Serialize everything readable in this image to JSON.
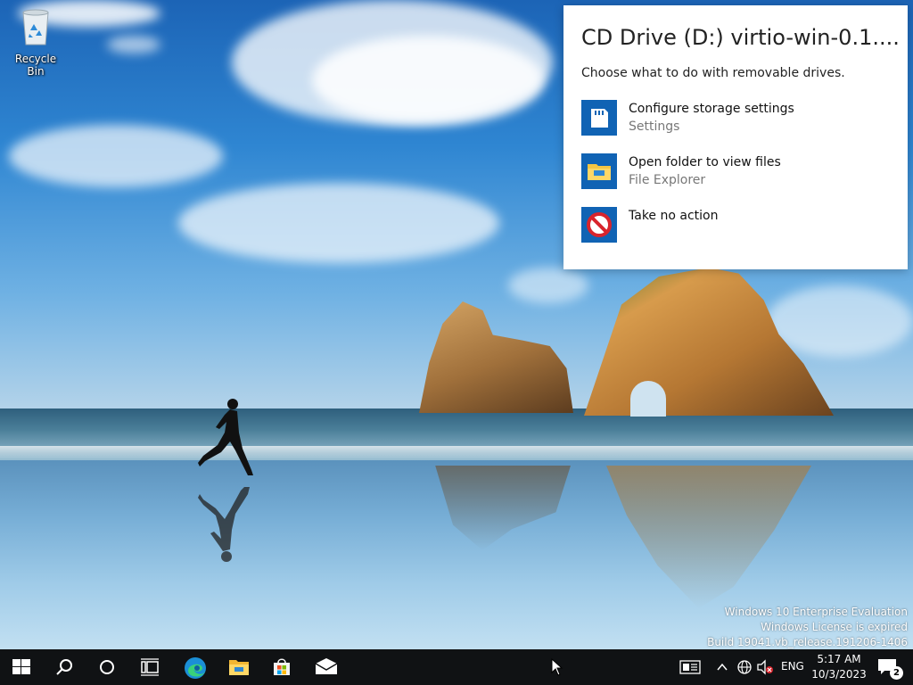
{
  "desktop": {
    "recycle_bin_label": "Recycle Bin"
  },
  "watermark": {
    "line1": "Windows 10 Enterprise Evaluation",
    "line2": "Windows License is expired",
    "line3": "Build 19041.vb_release.191206-1406"
  },
  "autoplay": {
    "title": "CD Drive (D:) virtio-win-0.1....",
    "subtitle": "Choose what to do with removable drives.",
    "options": [
      {
        "label": "Configure storage settings",
        "sublabel": "Settings",
        "icon": "sd-card-icon"
      },
      {
        "label": "Open folder to view files",
        "sublabel": "File Explorer",
        "icon": "folder-icon"
      },
      {
        "label": "Take no action",
        "sublabel": "",
        "icon": "no-action-icon"
      }
    ],
    "accent": "#1063b4"
  },
  "taskbar": {
    "background": "#101214",
    "pinned": [
      "start-icon",
      "search-icon",
      "cortana-icon",
      "task-view-icon",
      "edge-icon",
      "file-explorer-icon",
      "store-icon",
      "mail-icon"
    ],
    "tray": {
      "language": "ENG",
      "time": "5:17 AM",
      "date": "10/3/2023",
      "notification_count": "2"
    }
  }
}
